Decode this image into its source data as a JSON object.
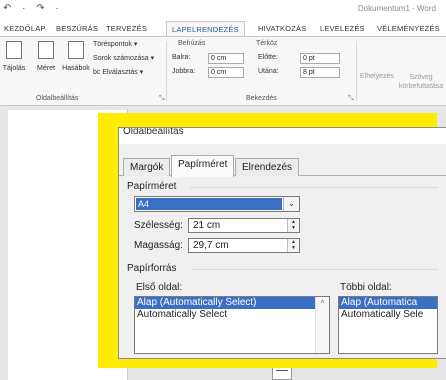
{
  "titlebar": {
    "qat": "↶ · ↷ ·",
    "doc_title": "Dokumentum1 - Word"
  },
  "tabs": [
    "KEZDŐLAP",
    "BESZÚRÁS",
    "TERVEZÉS",
    "LAPELRENDEZÉS",
    "HIVATKOZÁS",
    "LEVELEZÉS",
    "VÉLEMÉNYEZÉS"
  ],
  "ribbon": {
    "big_buttons": [
      "Tájolás",
      "Méret",
      "Hasábok"
    ],
    "small_commands": [
      "Töréspontok ▾",
      "Sorok számozása ▾",
      "bc Elválasztás ▾"
    ],
    "group_oldal": "Oldalbeállítás",
    "indent_title": "Behúzás",
    "spacing_title": "Térköz",
    "left_label": "Balra:",
    "left_value": "0 cm",
    "right_label": "Jobbra:",
    "right_value": "0 cm",
    "before_label": "Előtte:",
    "before_value": "0 pt",
    "after_label": "Utána:",
    "after_value": "8 pt",
    "group_bekezdes": "Bekezdés",
    "position_label": "Elhelyezés",
    "wrap_label": "Szöveg körbefuttatása"
  },
  "dialog": {
    "title": "Oldalbeállítás",
    "tabs": [
      "Margók",
      "Papírméret",
      "Elrendezés"
    ],
    "active_tab": "Papírméret",
    "paper_size_section": "Papírméret",
    "paper_size_value": "A4",
    "width_label": "Szélesség:",
    "width_value": "21 cm",
    "height_label": "Magasság:",
    "height_value": "29,7 cm",
    "source_section": "Papírforrás",
    "first_page_label": "Első oldal:",
    "first_page_items": [
      "Alap (Automatically Select)",
      "Automatically Select"
    ],
    "other_pages_label": "Többi oldal:",
    "other_pages_items": [
      "Alap (Automatica",
      "Automatically Sele"
    ]
  },
  "highlight_color": "#ffec00",
  "accent_color": "#2a5a9c",
  "selection_color": "#3b6fc5"
}
